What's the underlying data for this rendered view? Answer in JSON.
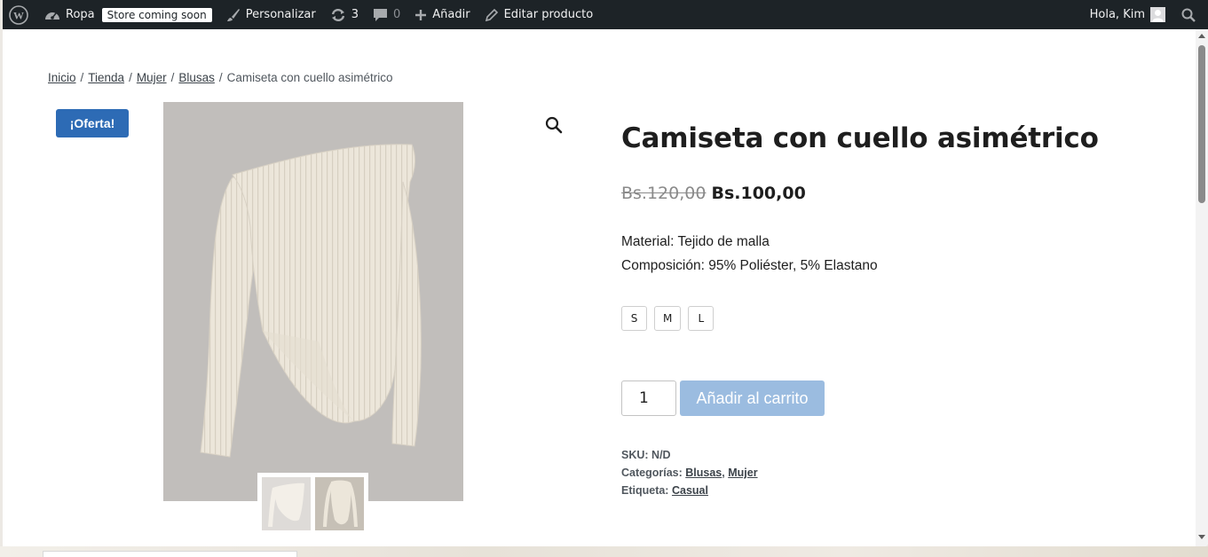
{
  "adminbar": {
    "site_name": "Ropa",
    "status_badge": "Store coming soon",
    "customize": "Personalizar",
    "updates_count": "3",
    "comments_count": "0",
    "add_new": "Añadir",
    "edit_product": "Editar producto",
    "greeting": "Hola, Kim"
  },
  "breadcrumb": {
    "items": [
      "Inicio",
      "Tienda",
      "Mujer",
      "Blusas"
    ],
    "current": "Camiseta con cuello asimétrico"
  },
  "product": {
    "sale_badge": "¡Oferta!",
    "title": "Camiseta con cuello asimétrico",
    "regular_price": "Bs.120,00",
    "sale_price": "Bs.100,00",
    "material": "Material: Tejido de malla",
    "composition": "Composición: 95% Poliéster, 5% Elastano",
    "sizes": [
      "S",
      "M",
      "L"
    ],
    "quantity": "1",
    "add_to_cart": "Añadir al carrito",
    "meta": {
      "sku_label": "SKU:",
      "sku_value": "N/D",
      "categories_label": "Categorías:",
      "categories": [
        "Blusas",
        "Mujer"
      ],
      "tag_label": "Etiqueta:",
      "tag": "Casual"
    }
  },
  "colors": {
    "adminbar_bg": "#1d2327",
    "sale_badge": "#2d6bb5",
    "add_to_cart": "#9bbce0"
  }
}
